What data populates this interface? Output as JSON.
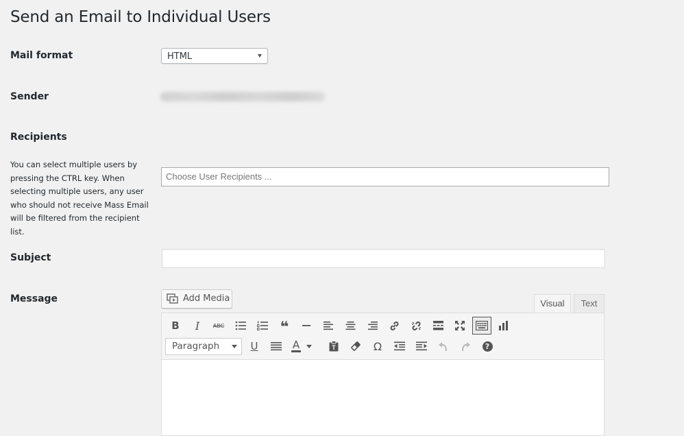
{
  "page": {
    "title": "Send an Email to Individual Users"
  },
  "labels": {
    "mail_format": "Mail format",
    "sender": "Sender",
    "recipients": "Recipients",
    "subject": "Subject",
    "message": "Message"
  },
  "mail_format": {
    "selected": "HTML"
  },
  "recipients": {
    "help": "You can select multiple users by pressing the CTRL key. When selecting multiple users, any user who should not receive Mass Email will be filtered from the recipient list.",
    "placeholder": "Choose User Recipients ..."
  },
  "subject": {
    "value": ""
  },
  "editor": {
    "add_media_label": "Add Media",
    "tabs": [
      "Visual",
      "Text"
    ],
    "active_tab": "Visual",
    "format_select": "Paragraph",
    "toolbar_row1": [
      "bold-icon",
      "italic-icon",
      "strikethrough-icon",
      "bullet-list-icon",
      "numbered-list-icon",
      "blockquote-icon",
      "horizontal-line-icon",
      "align-left-icon",
      "align-center-icon",
      "align-right-icon",
      "link-icon",
      "unlink-icon",
      "read-more-icon",
      "fullscreen-icon",
      "toolbar-toggle-icon",
      "chart-icon"
    ],
    "toolbar_row2": [
      "underline-icon",
      "justify-icon",
      "text-color-icon",
      "paste-text-icon",
      "clear-formatting-icon",
      "special-character-icon",
      "outdent-icon",
      "indent-icon",
      "undo-icon",
      "redo-icon",
      "help-icon"
    ],
    "glyphs": {
      "bold": "B",
      "italic": "I",
      "strikethrough": "ABC",
      "blockquote": "❝",
      "underline": "U",
      "text_color": "A",
      "omega": "Ω",
      "help": "?"
    }
  },
  "colors": {
    "background": "#f1f1f1",
    "text": "#23282d",
    "icon": "#555555"
  }
}
